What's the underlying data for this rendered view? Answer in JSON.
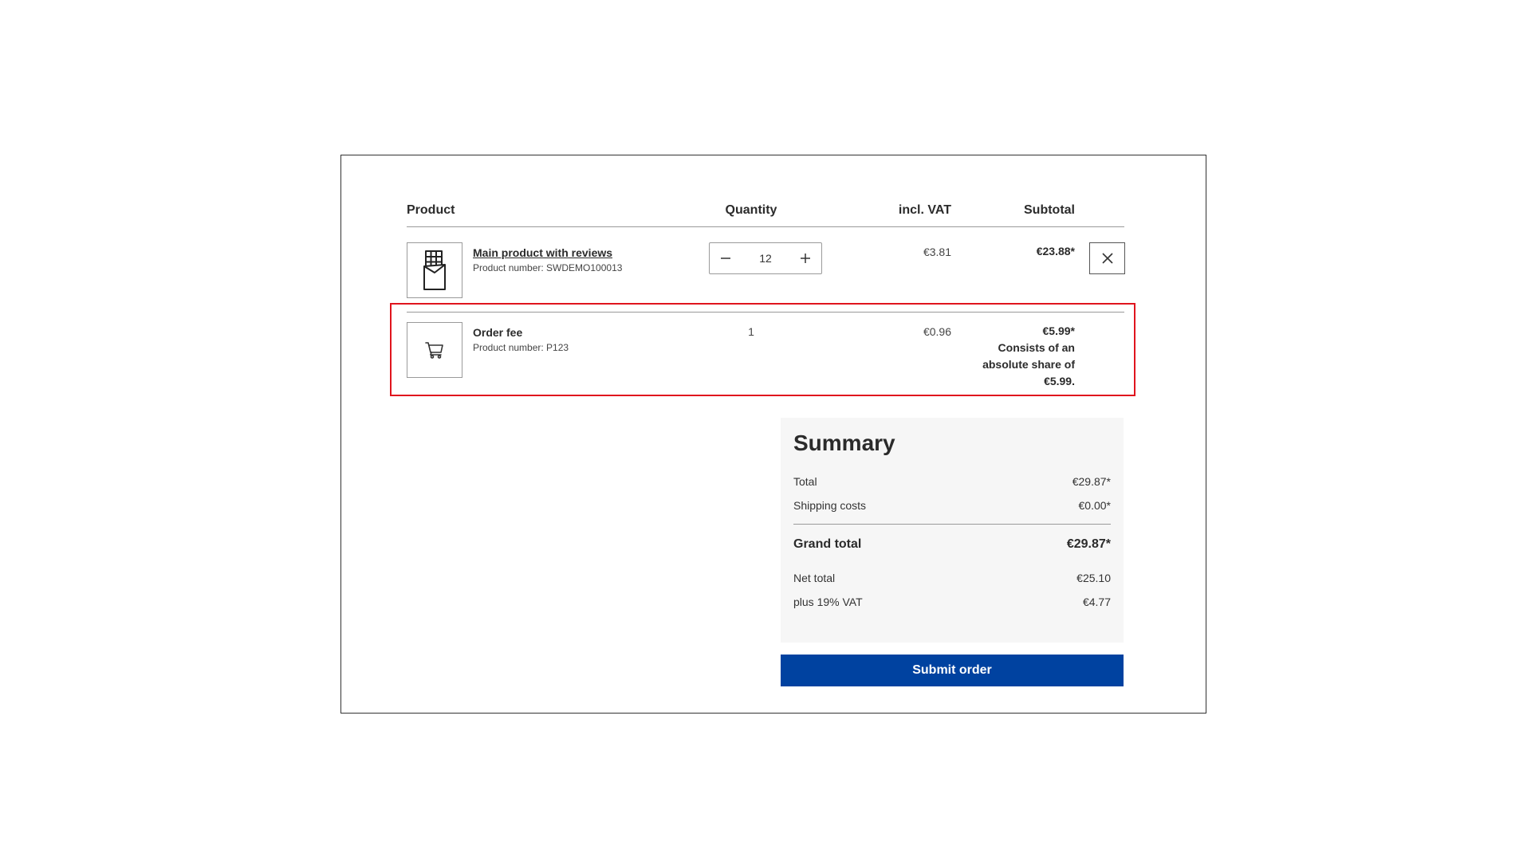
{
  "table": {
    "headers": {
      "product": "Product",
      "quantity": "Quantity",
      "incl_vat": "incl. VAT",
      "subtotal": "Subtotal"
    }
  },
  "items": [
    {
      "name": "Main product with reviews",
      "product_number": "Product number: SWDEMO100013",
      "quantity": "12",
      "unit_price": "€3.81",
      "subtotal": "€23.88*",
      "thumbnail_icon": "chocolate-bar-icon"
    },
    {
      "name": "Order fee",
      "product_number": "Product number: P123",
      "quantity": "1",
      "unit_price": "€0.96",
      "subtotal": "€5.99*",
      "subtotal_note_lines": [
        "Consists of an",
        "absolute share of",
        "€5.99."
      ],
      "thumbnail_icon": "shopping-cart-icon"
    }
  ],
  "summary": {
    "title": "Summary",
    "total_label": "Total",
    "total_value": "€29.87*",
    "shipping_label": "Shipping costs",
    "shipping_value": "€0.00*",
    "grand_total_label": "Grand total",
    "grand_total_value": "€29.87*",
    "net_total_label": "Net total",
    "net_total_value": "€25.10",
    "vat_label": "plus 19% VAT",
    "vat_value": "€4.77"
  },
  "submit_label": "Submit order",
  "colors": {
    "primary_button": "#0042a0",
    "highlight_border": "#e0141e",
    "summary_background": "#f6f6f6"
  }
}
